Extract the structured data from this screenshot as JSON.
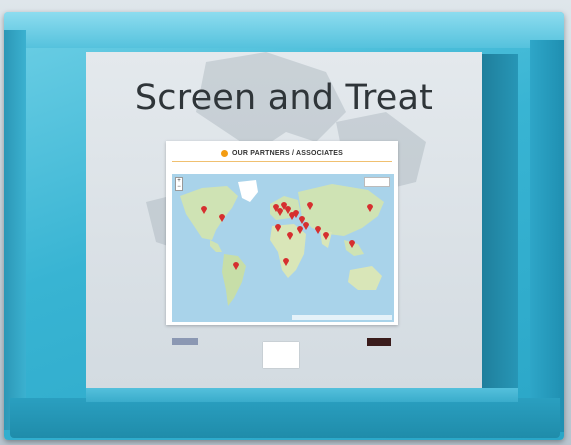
{
  "slide": {
    "title": "Screen and Treat"
  },
  "card": {
    "title": "OUR PARTNERS / ASSOCIATES",
    "accent_color": "#f39c12"
  },
  "map": {
    "zoom_in": "+",
    "zoom_out": "−",
    "marker_color": "#d62f2f",
    "water_color": "#a9d3ea",
    "land_color": "#cfe3b4"
  },
  "frame": {
    "box_color": "#38b4d3"
  }
}
